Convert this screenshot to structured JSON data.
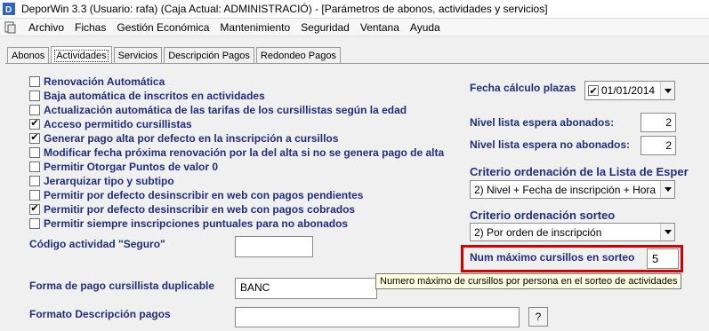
{
  "window": {
    "title": "DeporWin 3.3  (Usuario: rafa)  (Caja Actual: ADMINISTRACIÓ) - [Parámetros de abonos, actividades y servicios]"
  },
  "menu": [
    "Archivo",
    "Fichas",
    "Gestión Económica",
    "Mantenimiento",
    "Seguridad",
    "Ventana",
    "Ayuda"
  ],
  "tabs": [
    "Abonos",
    "Actividades",
    "Servicios",
    "Descripción Pagos",
    "Redondeo Pagos"
  ],
  "active_tab": "Actividades",
  "checkboxes": [
    {
      "label": "Renovación Automática",
      "checked": false
    },
    {
      "label": "Baja automática de inscritos en actividades",
      "checked": false
    },
    {
      "label": "Actualización automática de las tarifas de los cursillistas según la edad",
      "checked": false
    },
    {
      "label": "Acceso permitido cursillistas",
      "checked": true
    },
    {
      "label": "Generar pago alta por defecto en la inscripción a cursillos",
      "checked": true
    },
    {
      "label": "Modificar fecha próxima renovación por la del alta si no se genera pago de alta",
      "checked": false
    },
    {
      "label": "Permitir Otorgar Puntos de valor 0",
      "checked": false
    },
    {
      "label": "Jerarquizar tipo y subtipo",
      "checked": false
    },
    {
      "label": "Permitir por defecto desinscribir en web con pagos pendientes",
      "checked": false
    },
    {
      "label": "Permitir por defecto desinscribir en web con pagos cobrados",
      "checked": true
    },
    {
      "label": "Permitir siempre inscripciones puntuales para no abonados",
      "checked": false
    }
  ],
  "left_fields": {
    "seguro_label": "Código actividad \"Seguro\"",
    "seguro_value": "",
    "forma_pago_label": "Forma de pago cursillista duplicable",
    "forma_pago_value": "BANC",
    "formato_label": "Formato Descripción pagos",
    "formato_value": "",
    "help_button": "?"
  },
  "right": {
    "fecha_label": "Fecha cálculo plazas",
    "fecha_checked": true,
    "fecha_value": "01/01/2014",
    "nivel_abonados_label": "Nivel lista espera abonados:",
    "nivel_abonados_value": "2",
    "nivel_no_abonados_label": "Nivel lista espera no abonados:",
    "nivel_no_abonados_value": "2",
    "criterio_lista_label": "Criterio ordenación de la Lista de Esper",
    "criterio_lista_value": "2) Nivel + Fecha de inscripción + Hora",
    "criterio_sorteo_label": "Criterio ordenación sorteo",
    "criterio_sorteo_value": "2) Por orden de inscripción",
    "num_max_label": "Num máximo cursillos en sorteo",
    "num_max_value": "5"
  },
  "tooltip": "Numero máximo de cursillos por persona en el sorteo de actividades",
  "colors": {
    "label_blue": "#1f2f7d",
    "highlight_red": "#d40000",
    "tooltip_bg": "#ffffe1"
  }
}
